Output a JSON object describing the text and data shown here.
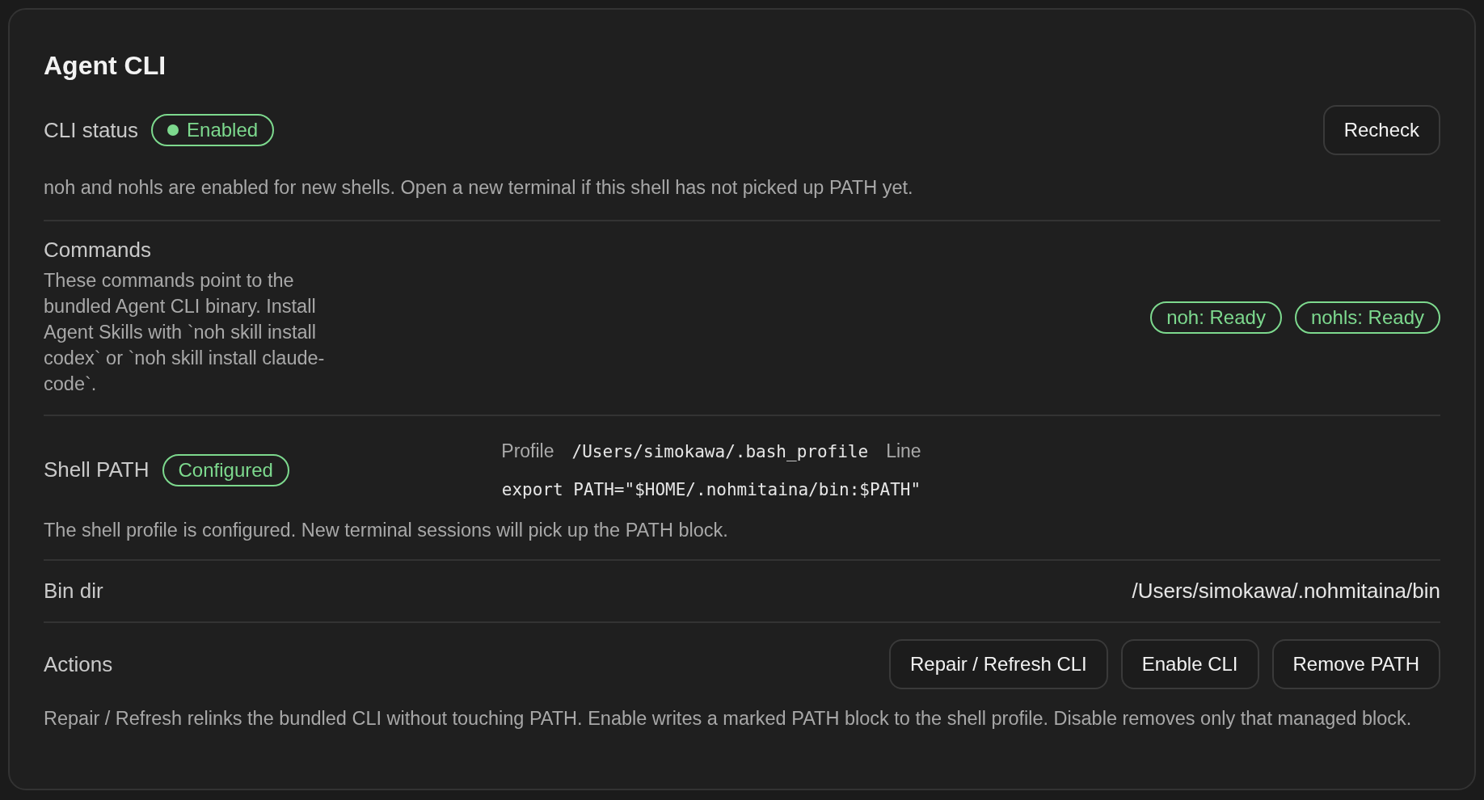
{
  "title": "Agent CLI",
  "cli_status": {
    "label": "CLI status",
    "badge": {
      "text": "Enabled",
      "dot": true
    },
    "button": "Recheck",
    "description": "noh and nohls are enabled for new shells. Open a new terminal if this shell has not picked up PATH yet."
  },
  "commands": {
    "label": "Commands",
    "description": "These commands point to the bundled Agent CLI binary. Install Agent Skills with `noh skill install codex` or `noh skill install claude-code`.",
    "badges": [
      {
        "text": "noh: Ready",
        "dot": false
      },
      {
        "text": "nohls: Ready",
        "dot": false
      }
    ]
  },
  "shell_path": {
    "label": "Shell PATH",
    "badge": {
      "text": "Configured",
      "dot": false
    },
    "profile_label": "Profile",
    "profile_value": "/Users/simokawa/.bash_profile",
    "line_label": "Line",
    "line_value": "export PATH=\"$HOME/.nohmitaina/bin:$PATH\"",
    "description": "The shell profile is configured. New terminal sessions will pick up the PATH block."
  },
  "bin_dir": {
    "label": "Bin dir",
    "value": "/Users/simokawa/.nohmitaina/bin"
  },
  "actions": {
    "label": "Actions",
    "buttons": [
      "Repair / Refresh CLI",
      "Enable CLI",
      "Remove PATH"
    ],
    "description": "Repair / Refresh relinks the bundled CLI without touching PATH. Enable writes a marked PATH block to the shell profile. Disable removes only that managed block."
  }
}
